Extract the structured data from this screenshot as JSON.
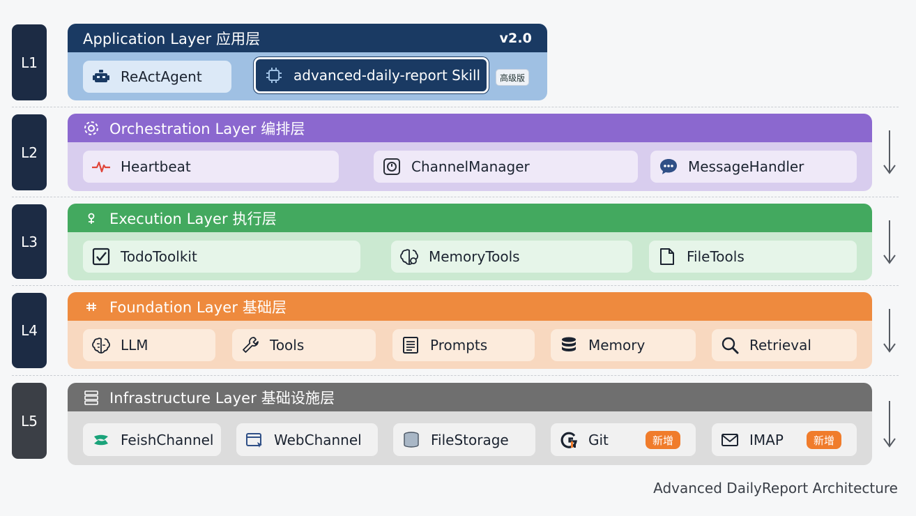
{
  "layers": [
    {
      "badge": "L1",
      "title": "Application Layer  应用层",
      "version": "v2.0",
      "items": [
        {
          "label": "ReActAgent",
          "icon": "robot-icon"
        },
        {
          "label": "advanced-daily-report Skill",
          "icon": "chip-icon",
          "tag": "高级版"
        }
      ]
    },
    {
      "badge": "L2",
      "title": "Orchestration Layer 编排层",
      "items": [
        {
          "label": "Heartbeat",
          "icon": "heartbeat-icon"
        },
        {
          "label": "ChannelManager",
          "icon": "dial-icon"
        },
        {
          "label": "MessageHandler",
          "icon": "chat-bubble-icon"
        }
      ]
    },
    {
      "badge": "L3",
      "title": "Execution Layer 执行层",
      "items": [
        {
          "label": "TodoToolkit",
          "icon": "checkbox-icon"
        },
        {
          "label": "MemoryTools",
          "icon": "brain-icon"
        },
        {
          "label": "FileTools",
          "icon": "file-icon"
        }
      ]
    },
    {
      "badge": "L4",
      "title": "Foundation Layer 基础层",
      "items": [
        {
          "label": "LLM",
          "icon": "brain-icon"
        },
        {
          "label": "Tools",
          "icon": "wrench-icon"
        },
        {
          "label": "Prompts",
          "icon": "document-icon"
        },
        {
          "label": "Memory",
          "icon": "database-icon"
        },
        {
          "label": "Retrieval",
          "icon": "magnifier-icon"
        }
      ]
    },
    {
      "badge": "L5",
      "title": "Infrastructure Layer 基础设施层",
      "items": [
        {
          "label": "FeishChannel",
          "icon": "feishu-logo-icon"
        },
        {
          "label": "WebChannel",
          "icon": "browser-window-icon"
        },
        {
          "label": "FileStorage",
          "icon": "storage-stack-icon"
        },
        {
          "label": "Git",
          "icon": "git-logo-icon",
          "tag": "新增"
        },
        {
          "label": "IMAP",
          "icon": "envelope-icon",
          "tag": "新增"
        }
      ]
    }
  ],
  "caption": "Advanced DailyReport Architecture",
  "colors": {
    "l1": "#1a3a63",
    "l2": "#8b68cf",
    "l3": "#43a95f",
    "l4": "#ee8a3e",
    "l5": "#6f6f6f",
    "badge": "#1c2b44",
    "badge_l5": "#3b3f46",
    "new_tag": "#f07c2b"
  }
}
